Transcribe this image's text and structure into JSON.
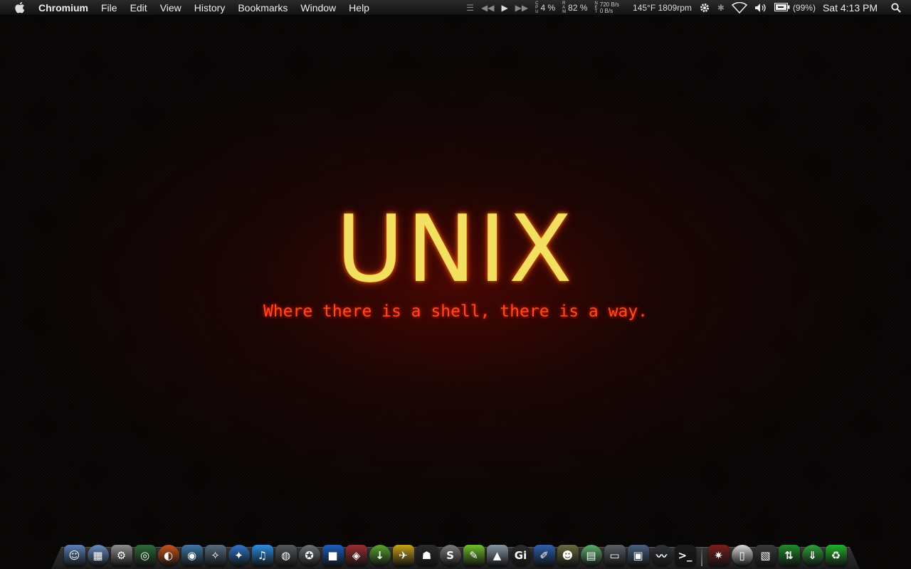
{
  "menubar": {
    "app_name": "Chromium",
    "menus": [
      "File",
      "Edit",
      "View",
      "History",
      "Bookmarks",
      "Window",
      "Help"
    ],
    "extras": {
      "cpu_label": "CPU",
      "cpu_value": "4 %",
      "ram_label": "RAM",
      "ram_value": "82 %",
      "net_label": "NET",
      "net_up": "720 B/s",
      "net_down": "0 B/s",
      "temp_fan": "145°F 1809rpm",
      "battery": "(99%)",
      "clock": "Sat 4:13 PM"
    },
    "icons": [
      "apple-icon",
      "list-icon",
      "rewind-icon",
      "play-icon",
      "fast-forward-icon",
      "gear-icon",
      "bluetooth-icon",
      "wifi-icon",
      "volume-icon",
      "battery-icon",
      "spotlight-search-icon"
    ]
  },
  "wallpaper": {
    "headline": "UNIX",
    "tagline": "Where there is a shell, there is a way."
  },
  "dock": {
    "items": [
      {
        "name": "finder-icon",
        "glyph": "☺",
        "color": "#5a7fb8"
      },
      {
        "name": "finder-window-icon",
        "glyph": "▦",
        "color": "#6a8cc4"
      },
      {
        "name": "system-preferences-icon",
        "glyph": "⚙",
        "color": "#8d8d8d"
      },
      {
        "name": "radar-icon",
        "glyph": "◎",
        "color": "#2e6b3a"
      },
      {
        "name": "firefox-icon",
        "glyph": "◐",
        "color": "#c8541c"
      },
      {
        "name": "camino-icon",
        "glyph": "◉",
        "color": "#3f77a8"
      },
      {
        "name": "compass-icon",
        "glyph": "✧",
        "color": "#586b80"
      },
      {
        "name": "safari-icon",
        "glyph": "✦",
        "color": "#2f76c9"
      },
      {
        "name": "itunes-icon",
        "glyph": "♫",
        "color": "#2a8fe0"
      },
      {
        "name": "speaker-icon",
        "glyph": "◍",
        "color": "#55595e"
      },
      {
        "name": "robot-icon",
        "glyph": "✪",
        "color": "#6b7178"
      },
      {
        "name": "blue-square-icon",
        "glyph": "■",
        "color": "#1e5fc0"
      },
      {
        "name": "cube-icon",
        "glyph": "◈",
        "color": "#9a3030"
      },
      {
        "name": "download-arrow-icon",
        "glyph": "↓",
        "color": "#5aa630"
      },
      {
        "name": "transmit-icon",
        "glyph": "✈",
        "color": "#c9a21c"
      },
      {
        "name": "ninja-icon",
        "glyph": "☗",
        "color": "#2a2a2a"
      },
      {
        "name": "skype-icon",
        "glyph": "S",
        "color": "#7a7a7a"
      },
      {
        "name": "evernote-icon",
        "glyph": "✎",
        "color": "#6fbf2a"
      },
      {
        "name": "vlc-icon",
        "glyph": "▲",
        "color": "#8796a6"
      },
      {
        "name": "gi-icon",
        "glyph": "Gi",
        "color": "#2b2b2b"
      },
      {
        "name": "coda-icon",
        "glyph": "✐",
        "color": "#2f5fb0"
      },
      {
        "name": "photo-booth-icon",
        "glyph": "☻",
        "color": "#6a6a40"
      },
      {
        "name": "notes-icon",
        "glyph": "▤",
        "color": "#5fae6a"
      },
      {
        "name": "disk-utility-icon",
        "glyph": "▭",
        "color": "#5a5f66"
      },
      {
        "name": "monitor-icon",
        "glyph": "▣",
        "color": "#4a6080"
      },
      {
        "name": "activity-monitor-icon",
        "glyph": "〰",
        "color": "#303438"
      },
      {
        "name": "terminal-icon",
        "glyph": ">_",
        "color": "#1a1a1a"
      },
      {
        "name": "beetle-icon",
        "glyph": "✷",
        "color": "#7a1e1e"
      },
      {
        "name": "document-icon",
        "glyph": "▯",
        "color": "#d8d8d8"
      },
      {
        "name": "clapper-icon",
        "glyph": "▧",
        "color": "#3a3a3a"
      },
      {
        "name": "sync-arrows-icon",
        "glyph": "⇅",
        "color": "#1e8a2a"
      },
      {
        "name": "green-download-icon",
        "glyph": "⇓",
        "color": "#2fa33a"
      },
      {
        "name": "trash-icon",
        "glyph": "♻",
        "color": "#22b22a"
      }
    ]
  }
}
